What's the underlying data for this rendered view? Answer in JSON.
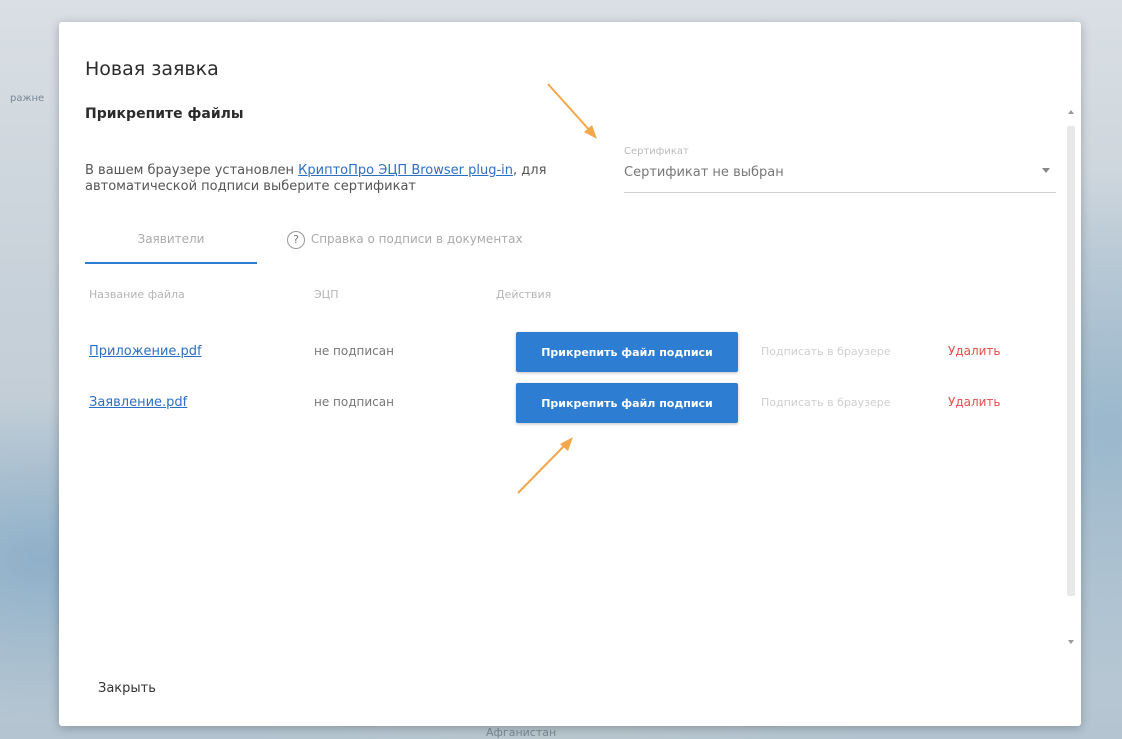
{
  "background": {
    "left_text": "ражне",
    "bottom_text": "Афганистан"
  },
  "dialog": {
    "title": "Новая заявка",
    "subtitle": "Прикрепите файлы",
    "info_prefix": "В вашем браузере установлен ",
    "info_link": "КриптоПро ЭЦП Browser plug-in",
    "info_suffix": ", для автоматической подписи выберите сертификат",
    "certificate": {
      "label": "Сертификат",
      "value": "Сертификат не выбран"
    },
    "tabs": [
      {
        "label": "Заявители"
      },
      {
        "label": "Справка о подписи в документах"
      }
    ],
    "help_glyph": "?",
    "table": {
      "headers": [
        "Название файла",
        "ЭЦП",
        "Действия"
      ],
      "rows": [
        {
          "file": "Приложение.pdf",
          "status": "не подписан",
          "attach": "Прикрепить файл подписи",
          "sign": "Подписать в браузере",
          "delete": "Удалить"
        },
        {
          "file": "Заявление.pdf",
          "status": "не подписан",
          "attach": "Прикрепить файл подписи",
          "sign": "Подписать в браузере",
          "delete": "Удалить"
        }
      ]
    },
    "close_label": "Закрыть"
  },
  "colors": {
    "accent": "#2d7dd2",
    "link": "#2d6fc4",
    "danger": "#e74c4c",
    "annotation_arrow": "#f2a74b"
  }
}
